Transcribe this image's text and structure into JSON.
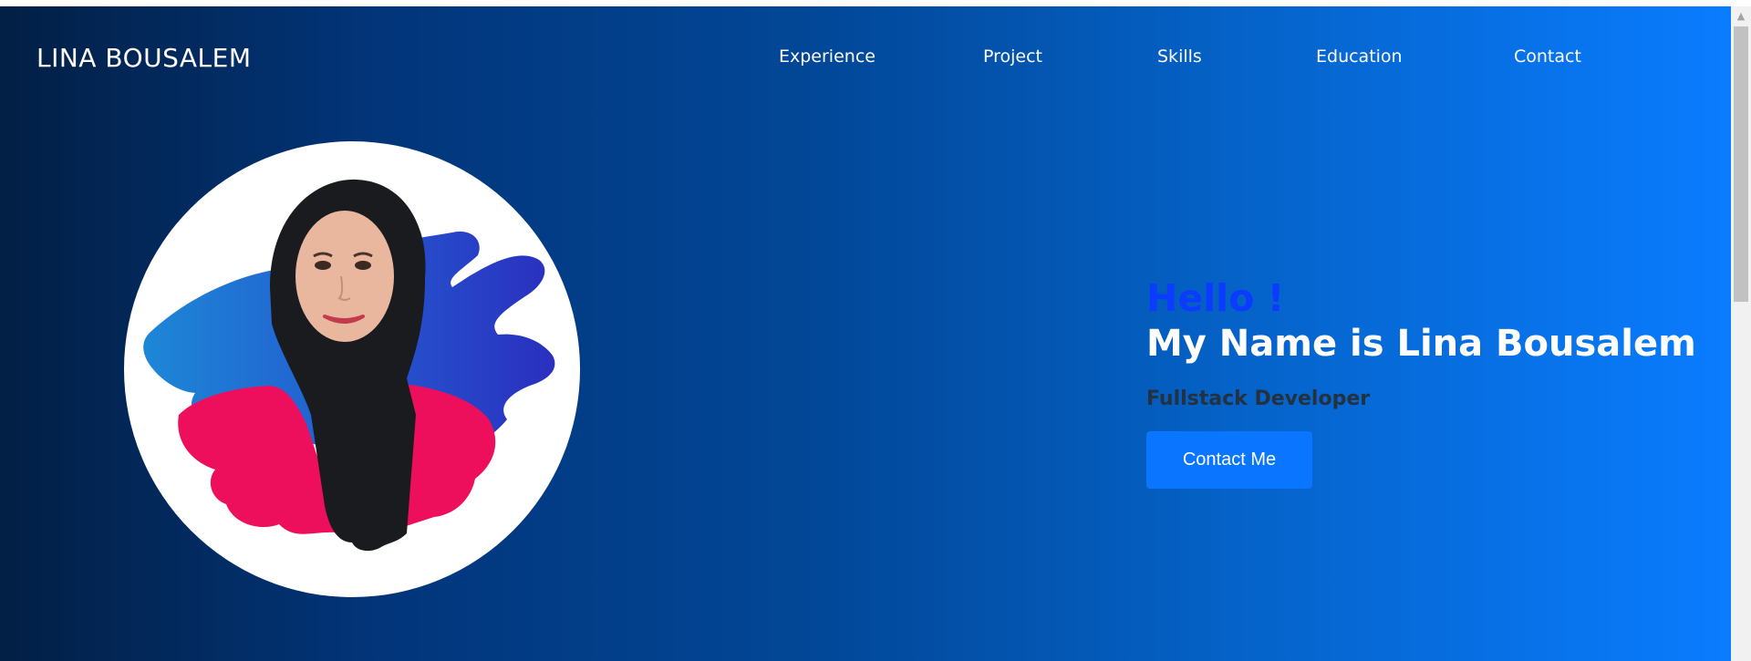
{
  "brand": {
    "name": "LINA BOUSALEM"
  },
  "nav": {
    "items": [
      {
        "label": "Experience"
      },
      {
        "label": "Project"
      },
      {
        "label": "Skills"
      },
      {
        "label": "Education"
      },
      {
        "label": "Contact"
      }
    ]
  },
  "hero": {
    "greeting": "Hello !",
    "name_line": "My Name is Lina Bousalem",
    "role": "Fullstack Developer",
    "cta_label": "Contact Me"
  },
  "colors": {
    "gradient_start": "#021f45",
    "gradient_end": "#0a7cff",
    "greeting": "#0b3bff",
    "cta": "#0a76ff",
    "brush_blue": "#2a55d0",
    "brush_pink": "#ee0f5c"
  },
  "icons": {
    "scroll_up": "scroll-up-arrow-icon"
  }
}
